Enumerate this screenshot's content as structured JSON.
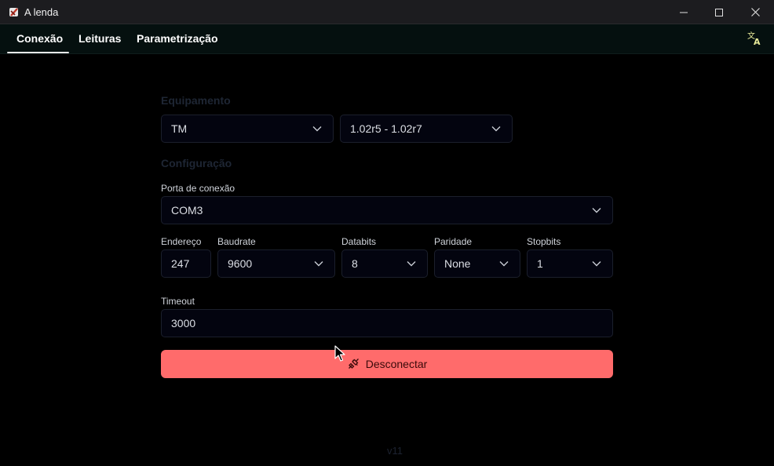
{
  "window": {
    "title": "A lenda"
  },
  "tabs": [
    {
      "label": "Conexão",
      "active": true
    },
    {
      "label": "Leituras",
      "active": false
    },
    {
      "label": "Parametrização",
      "active": false
    }
  ],
  "toolbar": {
    "translate_icon": "translate-icon"
  },
  "equipment": {
    "section_title": "Equipamento",
    "model": "TM",
    "firmware": "1.02r5 - 1.02r7"
  },
  "config": {
    "section_title": "Configuração",
    "port_label": "Porta de conexão",
    "port_value": "COM3",
    "address_label": "Endereço",
    "address_value": "247",
    "baudrate_label": "Baudrate",
    "baudrate_value": "9600",
    "databits_label": "Databits",
    "databits_value": "8",
    "parity_label": "Paridade",
    "parity_value": "None",
    "stopbits_label": "Stopbits",
    "stopbits_value": "1",
    "timeout_label": "Timeout",
    "timeout_value": "3000"
  },
  "actions": {
    "disconnect_label": "Desconectar",
    "disconnect_color": "#ff6b6b"
  },
  "footer": {
    "version": "v11"
  }
}
